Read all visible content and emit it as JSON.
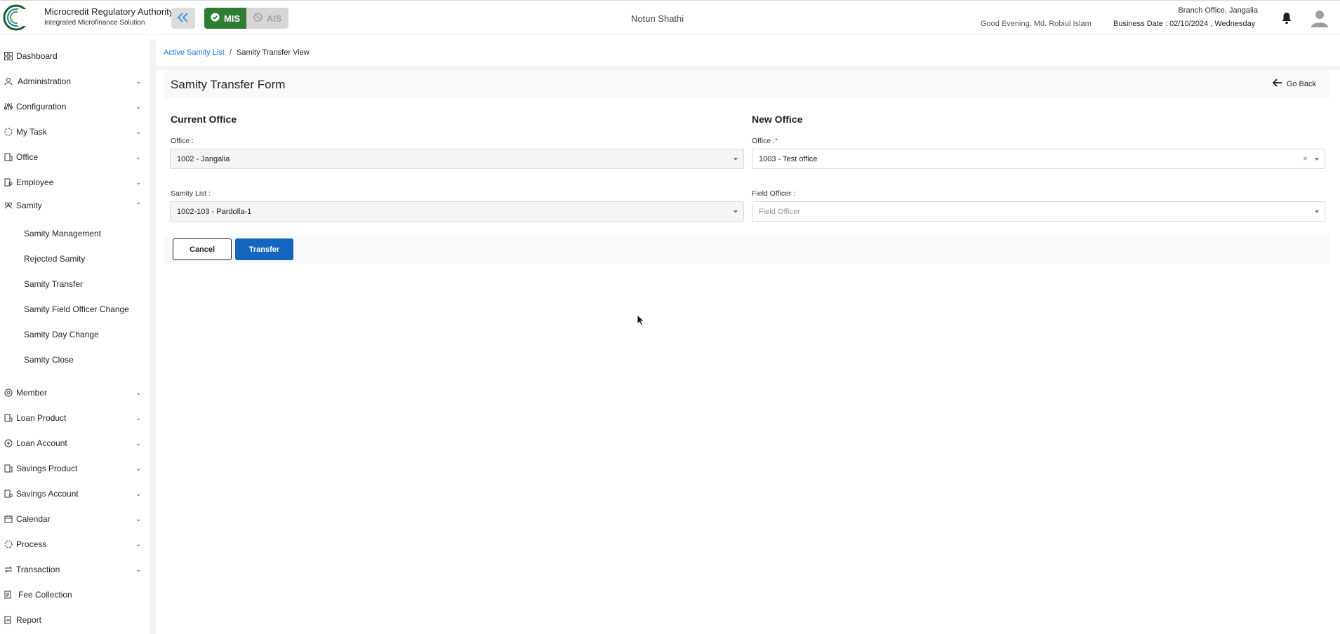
{
  "header": {
    "brand_title": "Microcredit Regulatory Authority",
    "brand_subtitle": "Integrated Microfinance Solution",
    "logo_text": "Microcredit Regulatory Authority",
    "mode_mis": "MIS",
    "mode_ais": "AIS",
    "org_name": "Notun Shathi",
    "greeting": "Good Evening, Md. Robiul Islam",
    "branch": "Branch Office, Jangalia",
    "business_date": "Business Date : 02/10/2024 , Wednesday",
    "accent_color": "#2e7d32"
  },
  "sidebar": {
    "items": [
      {
        "label": "Dashboard",
        "icon": "dashboard-icon"
      },
      {
        "label": "Administration",
        "icon": "admin-icon"
      },
      {
        "label": "Configuration",
        "icon": "sliders-icon"
      },
      {
        "label": "My Task",
        "icon": "task-icon"
      },
      {
        "label": "Office",
        "icon": "office-icon"
      },
      {
        "label": "Employee",
        "icon": "employee-icon"
      },
      {
        "label": "Samity",
        "icon": "samity-icon"
      },
      {
        "label": "Member",
        "icon": "member-icon"
      },
      {
        "label": "Loan Product",
        "icon": "loan-product-icon"
      },
      {
        "label": "Loan Account",
        "icon": "loan-account-icon"
      },
      {
        "label": "Savings Product",
        "icon": "savings-product-icon"
      },
      {
        "label": "Savings Account",
        "icon": "savings-account-icon"
      },
      {
        "label": "Calendar",
        "icon": "calendar-icon"
      },
      {
        "label": "Process",
        "icon": "process-icon"
      },
      {
        "label": "Transaction",
        "icon": "transaction-icon"
      },
      {
        "label": "Fee Collection",
        "icon": "fee-icon"
      },
      {
        "label": "Report",
        "icon": "report-icon"
      }
    ],
    "samity_sub": [
      "Samity Management",
      "Rejected Samity",
      "Samity Transfer",
      "Samity Field Officer Change",
      "Samity Day Change",
      "Samity Close"
    ]
  },
  "breadcrumb": {
    "link": "Active Samity List",
    "separator": "/",
    "current": "Samity Transfer View"
  },
  "form": {
    "title": "Samity Transfer Form",
    "go_back": "Go Back",
    "current_office": {
      "heading": "Current Office",
      "office_label": "Office :",
      "office_value": "1002 - Jangalia",
      "samity_label": "Samity List :",
      "samity_value": "1002-103 - Pardolla-1"
    },
    "new_office": {
      "heading": "New Office",
      "office_label": "Office :",
      "required_mark": "*",
      "office_value": "1003 - Test office",
      "clear_symbol": "×",
      "field_officer_label": "Field Officer :",
      "field_officer_placeholder": "Field Officer"
    },
    "cancel_label": "Cancel",
    "transfer_label": "Transfer",
    "primary_color": "#1565c0"
  }
}
